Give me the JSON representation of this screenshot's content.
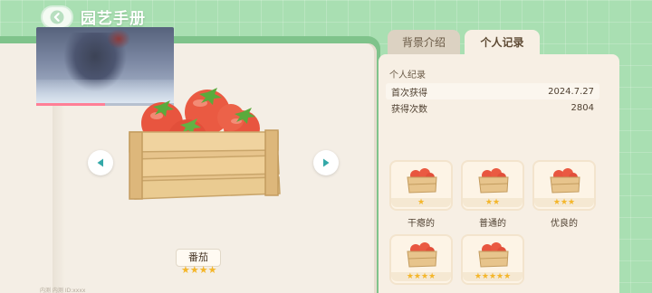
{
  "header": {
    "title": "园艺手册"
  },
  "item": {
    "name": "番茄",
    "stars": "★★★★"
  },
  "video": {
    "progress": 0.5
  },
  "watermark": "内测  内测  ID:xxxx",
  "tabs": {
    "background": "背景介绍",
    "record": "个人记录"
  },
  "record": {
    "heading": "个人纪录",
    "rows": [
      {
        "label": "首次获得",
        "value": "2024.7.27"
      },
      {
        "label": "获得次数",
        "value": "2804"
      }
    ]
  },
  "qualities": [
    {
      "label": "干瘪的",
      "stars": "★"
    },
    {
      "label": "普通的",
      "stars": "★★"
    },
    {
      "label": "优良的",
      "stars": "★★★"
    },
    {
      "label": "",
      "stars": "★★★★"
    },
    {
      "label": "",
      "stars": "★★★★★"
    }
  ],
  "colors": {
    "accent_green": "#7fc38b",
    "star": "#f4b62a",
    "paper": "#f4eee5"
  }
}
